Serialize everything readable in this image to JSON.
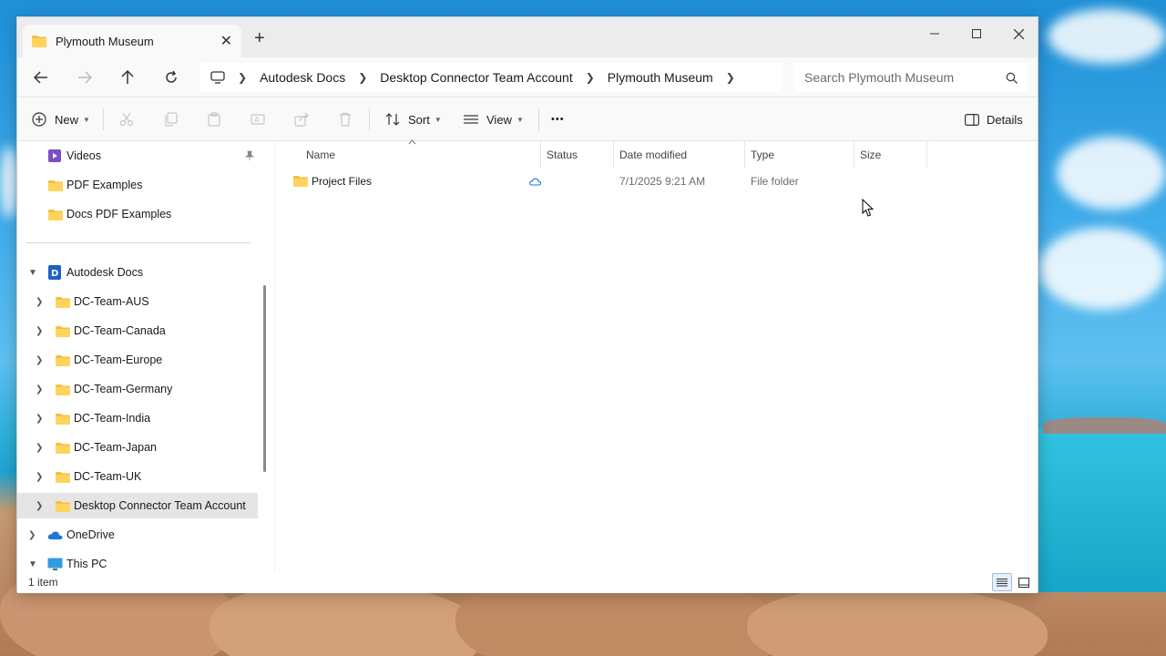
{
  "window": {
    "tab_title": "Plymouth Museum",
    "new_tab_symbol": "+",
    "close_symbol": "✕"
  },
  "address": {
    "breadcrumbs": [
      "Autodesk Docs",
      "Desktop Connector Team Account",
      "Plymouth Museum"
    ],
    "search_placeholder": "Search Plymouth Museum"
  },
  "toolbar": {
    "new_label": "New",
    "sort_label": "Sort",
    "view_label": "View",
    "more_label": "•••",
    "details_label": "Details"
  },
  "sidebar": {
    "quick_items": [
      {
        "label": "Videos",
        "icon": "video-folder-icon",
        "pinned": true
      },
      {
        "label": "PDF Examples",
        "icon": "folder-icon"
      },
      {
        "label": "Docs PDF Examples",
        "icon": "folder-icon"
      }
    ],
    "autodesk_docs": "Autodesk Docs",
    "docs_children": [
      "DC-Team-AUS",
      "DC-Team-Canada",
      "DC-Team-Europe",
      "DC-Team-Germany",
      "DC-Team-India",
      "DC-Team-Japan",
      "DC-Team-UK",
      "Desktop Connector Team Account"
    ],
    "selected_item": "Desktop Connector Team Account",
    "onedrive": "OneDrive",
    "this_pc": "This PC"
  },
  "columns": {
    "name": "Name",
    "status": "Status",
    "date_modified": "Date modified",
    "type": "Type",
    "size": "Size"
  },
  "files": [
    {
      "name": "Project Files",
      "status_icon": "cloud-icon",
      "date_modified": "7/1/2025 9:21 AM",
      "type": "File folder",
      "size": ""
    }
  ],
  "status_bar": {
    "item_count": "1 item"
  },
  "colors": {
    "folder": "#f4c041",
    "accent": "#0067c0",
    "selection": "#e5e5e5"
  }
}
